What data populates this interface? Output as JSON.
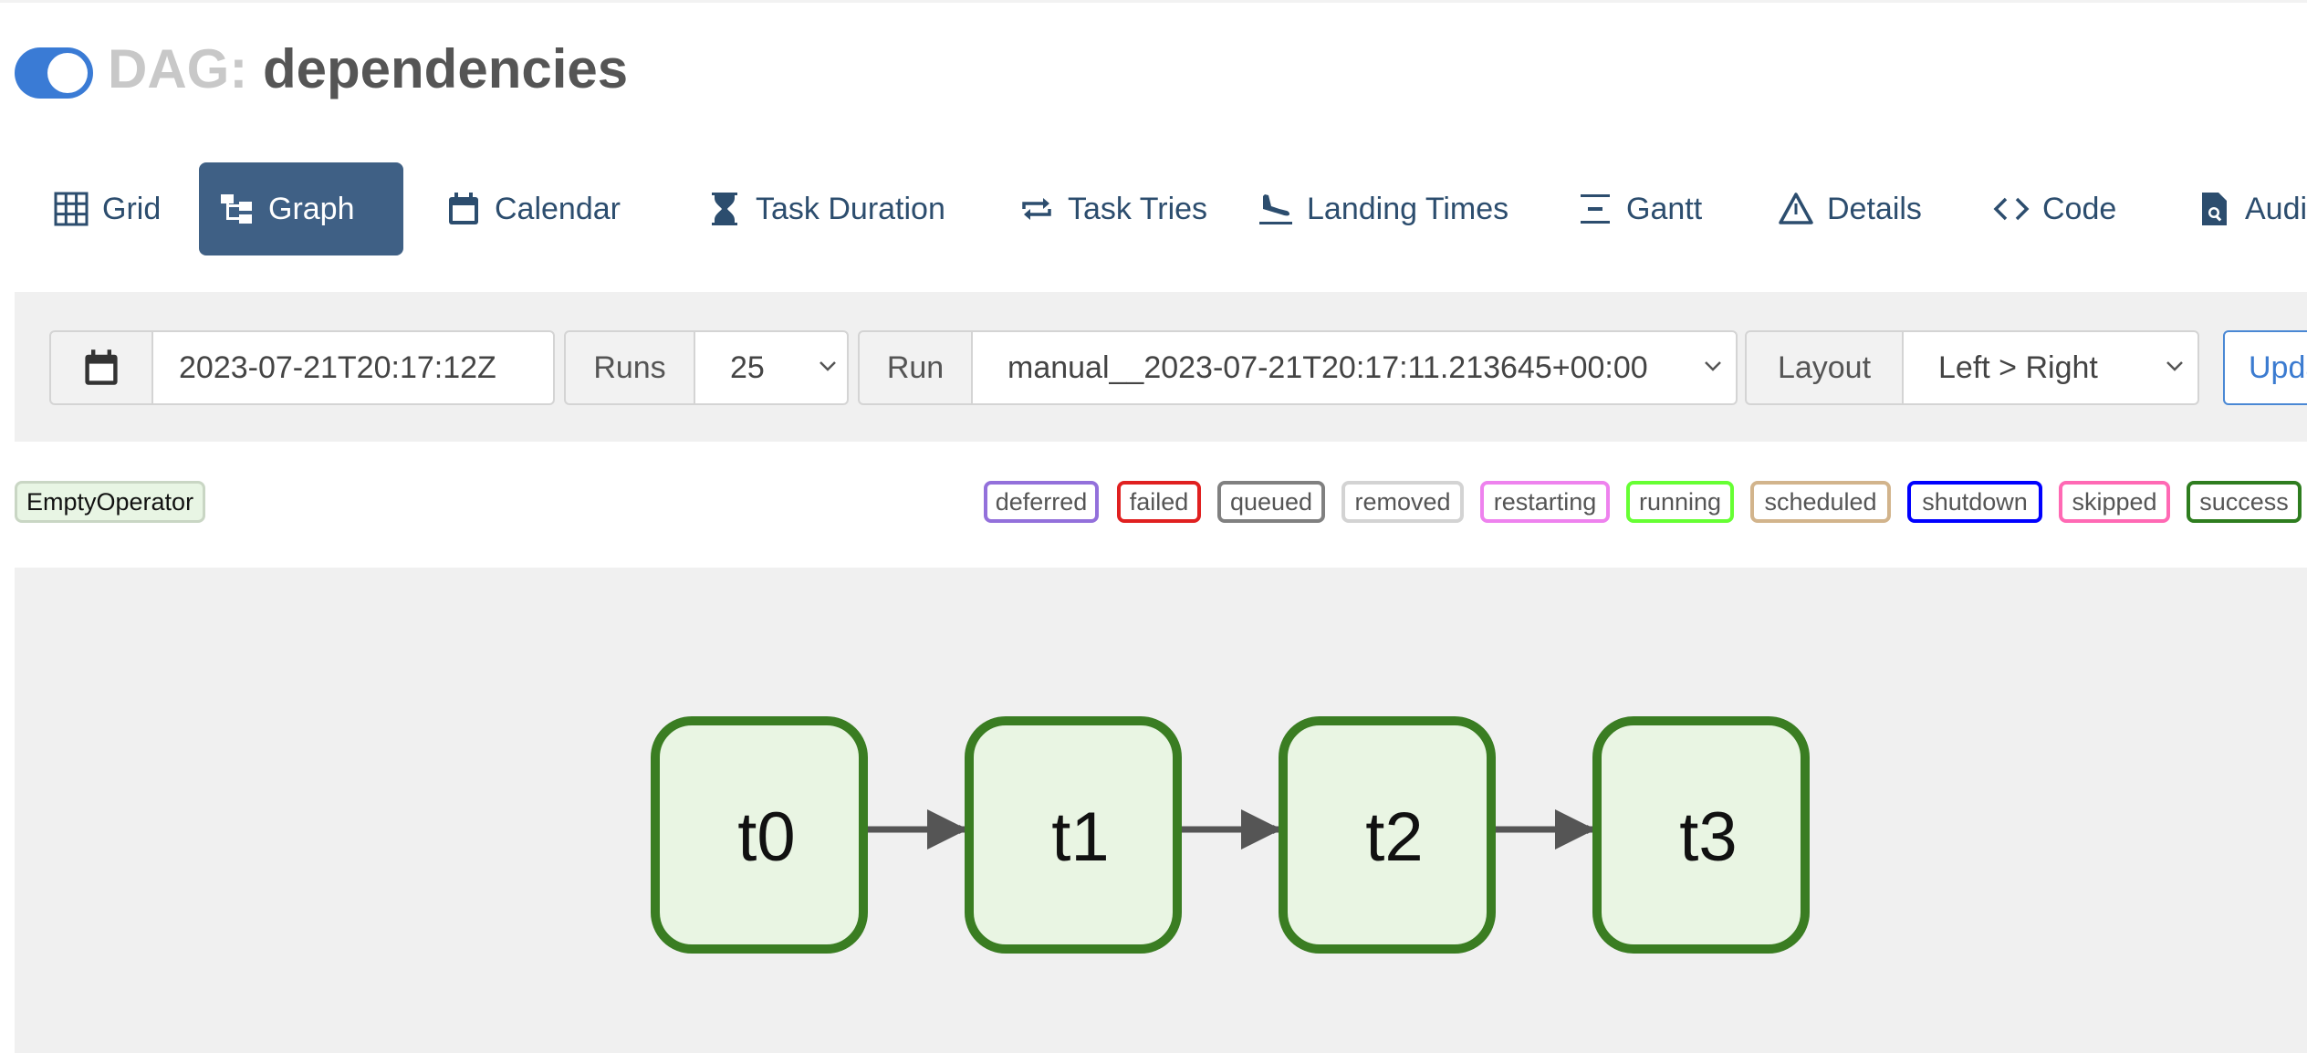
{
  "header": {
    "toggle_state": "on",
    "title_prefix": "DAG:",
    "dag_name": "dependencies"
  },
  "tabs": [
    {
      "label": "Grid",
      "icon": "grid-icon",
      "active": false
    },
    {
      "label": "Graph",
      "icon": "graph-icon",
      "active": true
    },
    {
      "label": "Calendar",
      "icon": "calendar-icon",
      "active": false
    },
    {
      "label": "Task Duration",
      "icon": "hourglass-icon",
      "active": false
    },
    {
      "label": "Task Tries",
      "icon": "repeat-icon",
      "active": false
    },
    {
      "label": "Landing Times",
      "icon": "plane-landing-icon",
      "active": false
    },
    {
      "label": "Gantt",
      "icon": "gantt-icon",
      "active": false
    },
    {
      "label": "Details",
      "icon": "warning-triangle-icon",
      "active": false
    },
    {
      "label": "Code",
      "icon": "code-icon",
      "active": false
    },
    {
      "label": "Audit",
      "icon": "file-search-icon",
      "active": false
    }
  ],
  "controls": {
    "base_date": "2023-07-21T20:17:12Z",
    "runs_label": "Runs",
    "runs_value": "25",
    "run_label": "Run",
    "run_value": "manual__2023-07-21T20:17:11.213645+00:00",
    "layout_label": "Layout",
    "layout_value": "Left > Right",
    "update_label": "Update"
  },
  "legend": {
    "operator": "EmptyOperator",
    "states": [
      {
        "label": "deferred",
        "color": "#9370db"
      },
      {
        "label": "failed",
        "color": "#e02020"
      },
      {
        "label": "queued",
        "color": "#808080"
      },
      {
        "label": "removed",
        "color": "#d3d3d3"
      },
      {
        "label": "restarting",
        "color": "#ee82ee"
      },
      {
        "label": "running",
        "color": "#66ff33"
      },
      {
        "label": "scheduled",
        "color": "#d2b48c"
      },
      {
        "label": "shutdown",
        "color": "#0000ff"
      },
      {
        "label": "skipped",
        "color": "#ff69b4"
      },
      {
        "label": "success",
        "color": "#2e7d1f"
      }
    ]
  },
  "graph": {
    "nodes": [
      {
        "id": "t0",
        "state": "success"
      },
      {
        "id": "t1",
        "state": "success"
      },
      {
        "id": "t2",
        "state": "success"
      },
      {
        "id": "t3",
        "state": "success"
      }
    ],
    "edges": [
      [
        "t0",
        "t1"
      ],
      [
        "t1",
        "t2"
      ],
      [
        "t2",
        "t3"
      ]
    ],
    "node_fill": "#e9f5e3",
    "node_stroke": "#3a7d22",
    "edge_color": "#555555"
  }
}
